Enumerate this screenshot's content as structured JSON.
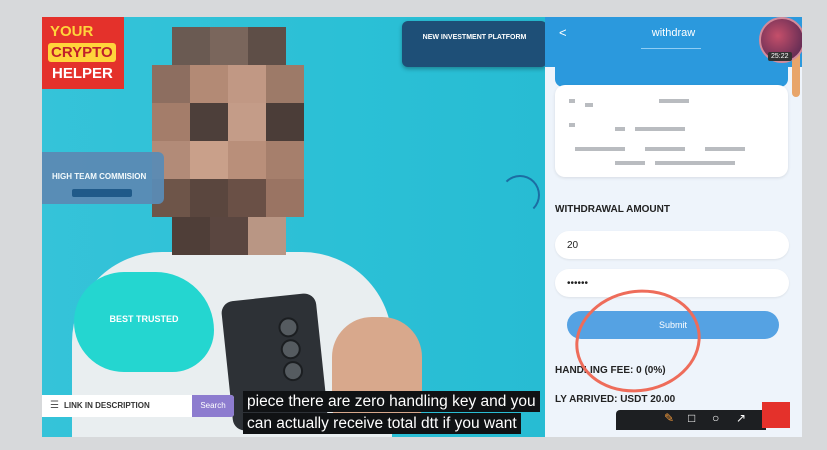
{
  "video": {
    "logo": {
      "line1": "YOUR",
      "line2": "CRYPTO",
      "line3": "HELPER"
    },
    "promo_top": "NEW INVESTMENT PLATFORM",
    "team_banner": {
      "title": "HIGH TEAM COMMISION"
    },
    "blob": {
      "title": "BEST TRUSTED"
    },
    "link_bar": {
      "text": "LINK IN DESCRIPTION",
      "button": "Search"
    },
    "subtitle_line1": "piece there are zero handling key and you",
    "subtitle_line2": "can actually receive total dtt if you want"
  },
  "panel": {
    "title": "withdraw",
    "back_icon": "chevron-left-icon",
    "timestamp": "25:22",
    "section_label": "WITHDRAWAL AMOUNT",
    "amount_value": "20",
    "password_value": "••••••",
    "submit_label": "Submit",
    "fee_label": "HANDLING FEE:",
    "fee_value": "0 (0%)",
    "arrived_label": "LY ARRIVED:",
    "arrived_value": "USDT 20.00"
  },
  "toolbar": {
    "icons": [
      "pen-icon",
      "square-icon",
      "circle-icon",
      "arrow-icon"
    ]
  },
  "colors": {
    "accent_blue": "#2b99dd",
    "annotation_red": "#ee6c5a",
    "logo_red": "#e4312b",
    "logo_yellow": "#ffd43b"
  }
}
